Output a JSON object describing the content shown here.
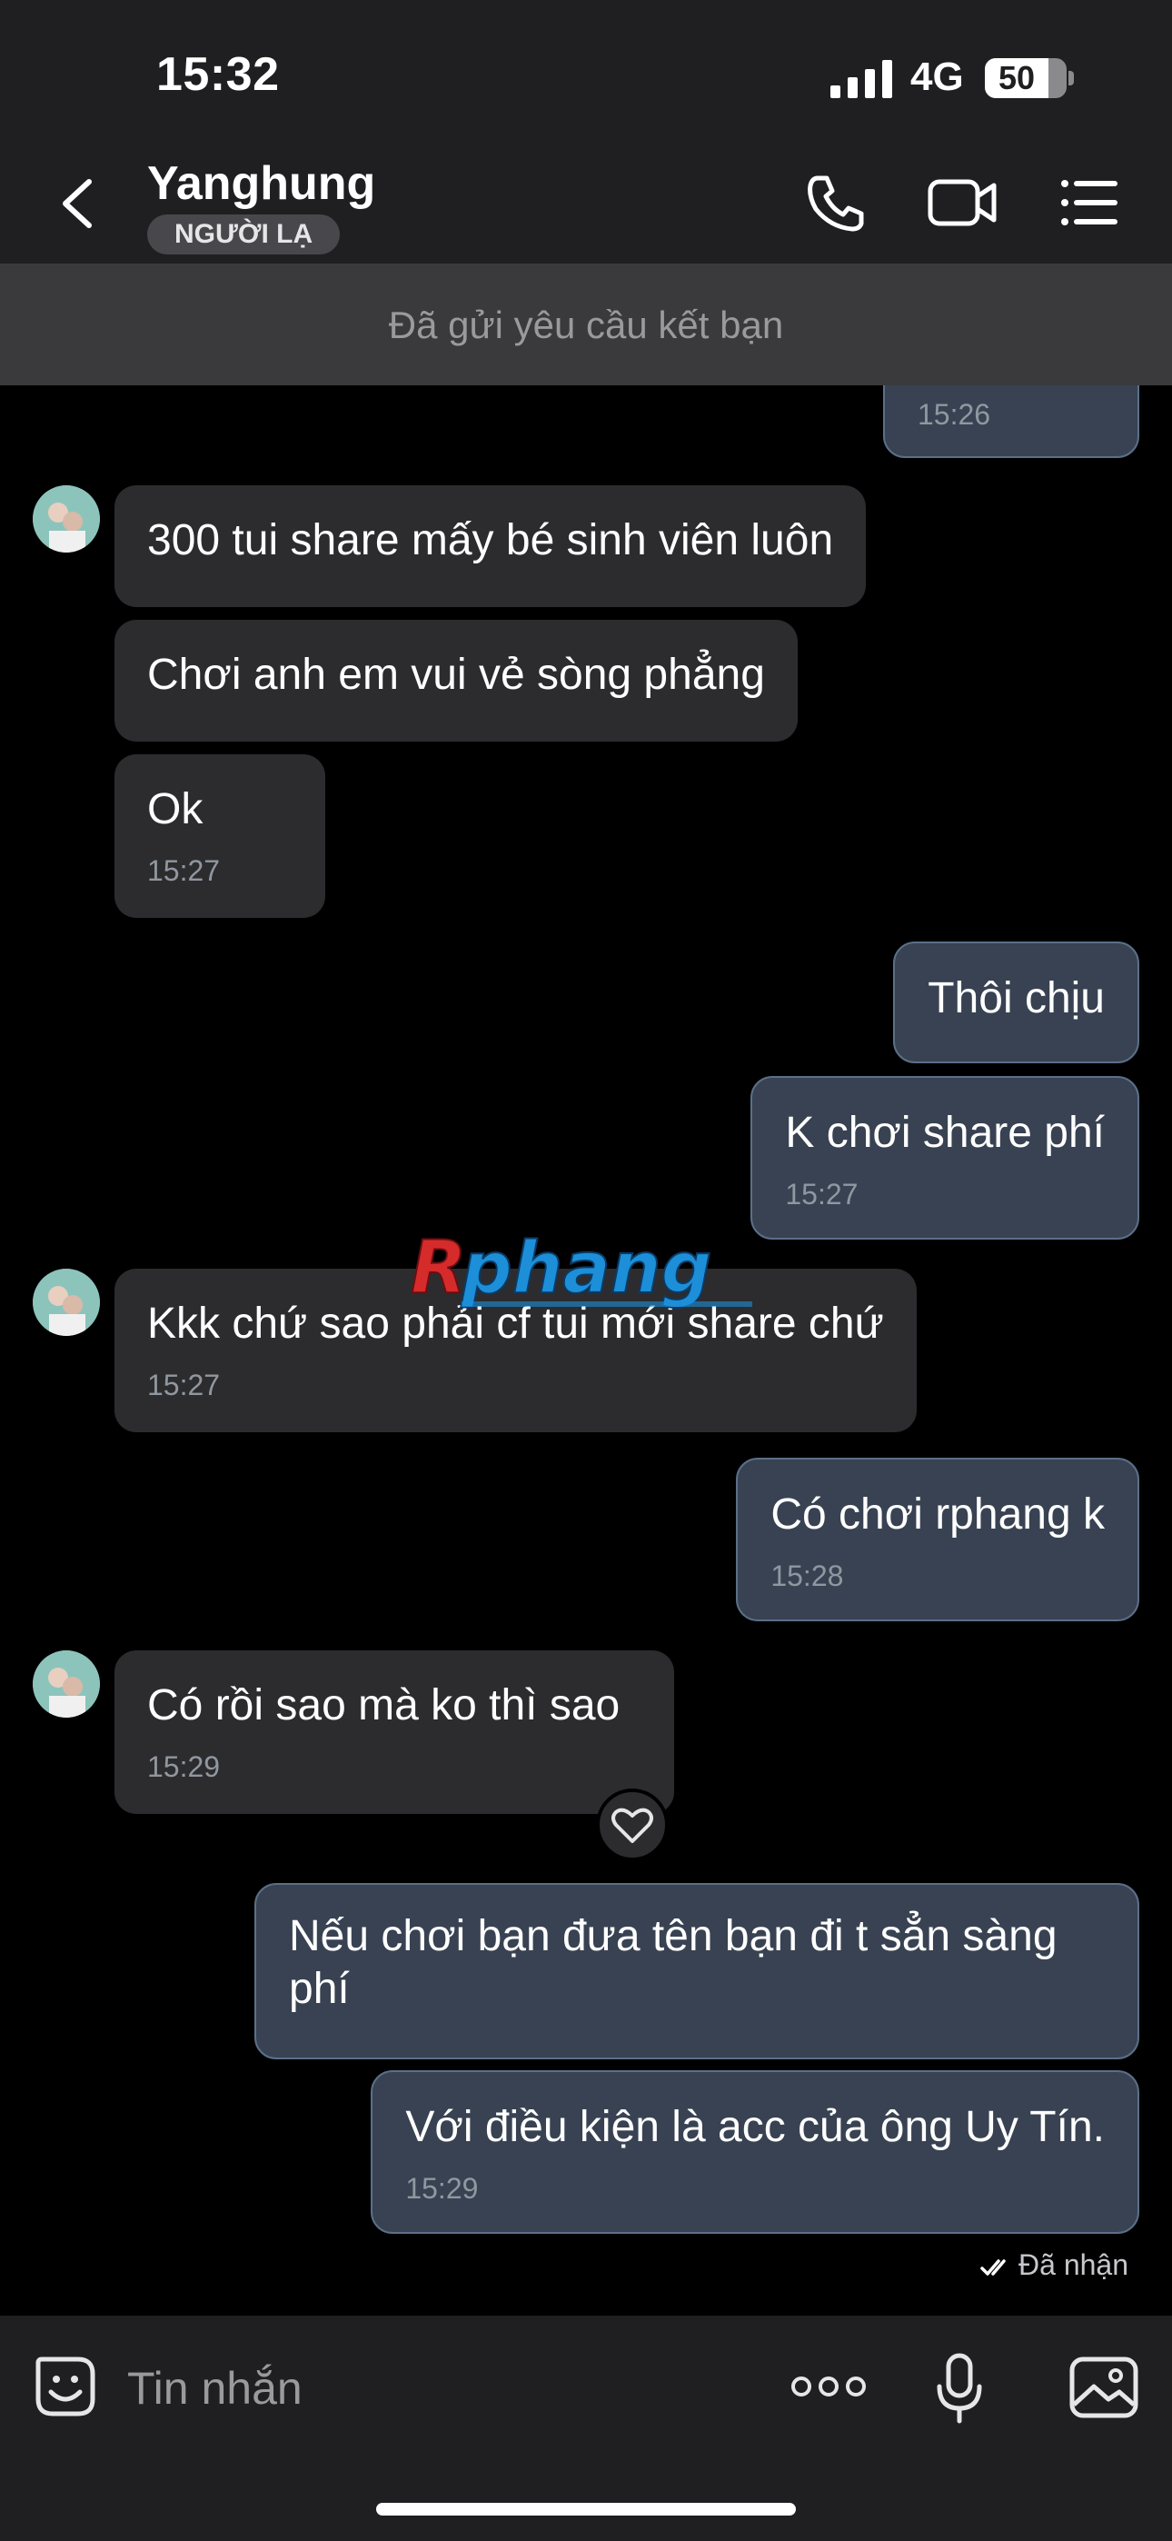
{
  "status_bar": {
    "time": "15:32",
    "network": "4G",
    "battery": "50"
  },
  "header": {
    "name": "Yanghung",
    "badge": "NGƯỜI LẠ"
  },
  "banner": {
    "text": "Đã gửi yêu cầu kết bạn"
  },
  "messages": [
    {
      "dir": "out",
      "text": "",
      "time": "15:26"
    },
    {
      "dir": "in",
      "text": "300 tui share mấy bé sinh viên luôn",
      "time": ""
    },
    {
      "dir": "in",
      "text": "Chơi anh em vui vẻ sòng phẳng",
      "time": ""
    },
    {
      "dir": "in",
      "text": "Ok",
      "time": "15:27"
    },
    {
      "dir": "out",
      "text": "Thôi chịu",
      "time": ""
    },
    {
      "dir": "out",
      "text": "K chơi share phí",
      "time": "15:27"
    },
    {
      "dir": "in",
      "text": "Kkk chứ sao phải cf tui mới share chứ",
      "time": "15:27"
    },
    {
      "dir": "out",
      "text": "Có chơi rphang k",
      "time": "15:28"
    },
    {
      "dir": "in",
      "text": "Có rồi sao mà ko thì sao",
      "time": "15:29",
      "reaction": "heart-icon"
    },
    {
      "dir": "out",
      "text": "Nếu chơi bạn đưa tên bạn đi t sẳn sàng phí",
      "time": ""
    },
    {
      "dir": "out",
      "text": "Với điều kiện là acc của ông Uy Tín.",
      "time": "15:29"
    }
  ],
  "receipt": {
    "text": "Đã nhận"
  },
  "watermark": {
    "text": "Rphang"
  },
  "input": {
    "placeholder": "Tin nhắn"
  },
  "icons": {
    "back": "chevron-left-icon",
    "call": "phone-icon",
    "video": "video-camera-icon",
    "menu": "list-icon",
    "sticker": "sticker-icon",
    "more": "more-icon",
    "mic": "microphone-icon",
    "image": "image-icon"
  },
  "colors": {
    "background": "#000000",
    "incoming_bubble": "#2c2c2e",
    "outgoing_bubble": "#384252",
    "outgoing_border": "#5a7088",
    "bar": "#1f1f21"
  }
}
